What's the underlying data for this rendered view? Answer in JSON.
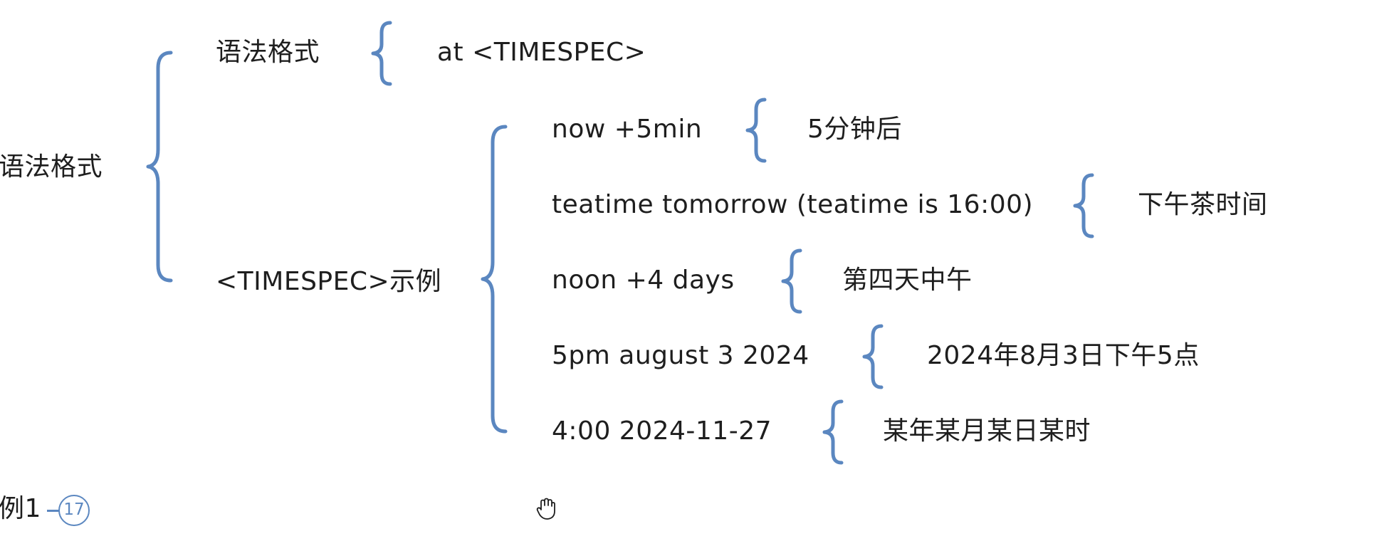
{
  "root": {
    "label": "语法格式",
    "children": [
      {
        "label": "语法格式",
        "child": "at <TIMESPEC>"
      },
      {
        "label": "<TIMESPEC>示例",
        "examples": [
          {
            "spec": "now +5min",
            "meaning": "5分钟后"
          },
          {
            "spec": "teatime tomorrow (teatime is 16:00)",
            "meaning": "下午茶时间"
          },
          {
            "spec": "noon +4 days",
            "meaning": "第四天中午"
          },
          {
            "spec": "5pm august 3 2024",
            "meaning": "2024年8月3日下午5点"
          },
          {
            "spec": "4:00 2024-11-27",
            "meaning": "某年某月某日某时"
          }
        ]
      }
    ]
  },
  "sibling": {
    "label": "例1",
    "collapsed_count": "17"
  },
  "colors": {
    "brace": "#5b87c0",
    "text": "#1e1e1e"
  }
}
